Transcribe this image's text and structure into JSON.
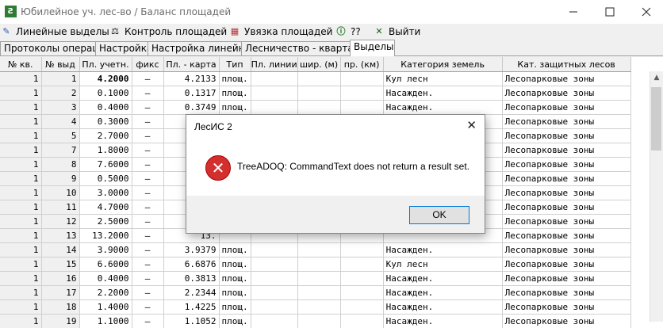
{
  "window": {
    "title": "Юбилейное уч. лес-во / Баланс площадей",
    "app_icon": "leaf-app-icon",
    "controls": [
      "minimize",
      "maximize",
      "close"
    ]
  },
  "toolbar": {
    "items": [
      {
        "label": "Линейные выделы",
        "icon": "pencil-icon"
      },
      {
        "label": "Контроль площадей",
        "icon": "scales-icon"
      },
      {
        "label": "Увязка площадей",
        "icon": "calculator-icon"
      },
      {
        "label": "??",
        "icon": "info-icon"
      },
      {
        "label": "Выйти",
        "icon": "close-x-icon"
      }
    ]
  },
  "tabs": [
    {
      "label": "Протоколы операций"
    },
    {
      "label": "Настройка"
    },
    {
      "label": "Настройка линейных"
    },
    {
      "label": "Лесничество - кварталы"
    },
    {
      "label": "Выделы",
      "active": true
    }
  ],
  "grid": {
    "columns": [
      "№ кв.",
      "№ выд",
      "Пл. учетн.",
      "фикс",
      "Пл. - карта",
      "Тип",
      "Пл. линии",
      "шир. (м)",
      "пр. (км)",
      "Категория земель",
      "Кат. защитных лесов"
    ],
    "rows": [
      [
        "1",
        "1",
        "4.2000",
        "–",
        "4.2133",
        "площ.",
        "",
        "",
        "",
        "Кул лесн",
        "Лесопарковые зоны"
      ],
      [
        "1",
        "2",
        "0.1000",
        "–",
        "0.1317",
        "площ.",
        "",
        "",
        "",
        "Насажден.",
        "Лесопарковые зоны"
      ],
      [
        "1",
        "3",
        "0.4000",
        "–",
        "0.3749",
        "площ.",
        "",
        "",
        "",
        "Насажден.",
        "Лесопарковые зоны"
      ],
      [
        "1",
        "4",
        "0.3000",
        "–",
        "0.",
        "",
        "",
        "",
        "",
        "",
        "Лесопарковые зоны"
      ],
      [
        "1",
        "5",
        "2.7000",
        "–",
        "2.",
        "",
        "",
        "",
        "",
        "",
        "Лесопарковые зоны"
      ],
      [
        "1",
        "7",
        "1.8000",
        "–",
        "1.",
        "",
        "",
        "",
        "",
        "",
        "Лесопарковые зоны"
      ],
      [
        "1",
        "8",
        "7.6000",
        "–",
        "7.",
        "",
        "",
        "",
        "",
        "",
        "Лесопарковые зоны"
      ],
      [
        "1",
        "9",
        "0.5000",
        "–",
        "0.",
        "",
        "",
        "",
        "",
        "",
        "Лесопарковые зоны"
      ],
      [
        "1",
        "10",
        "3.0000",
        "–",
        "3.",
        "",
        "",
        "",
        "",
        "",
        "Лесопарковые зоны"
      ],
      [
        "1",
        "11",
        "4.7000",
        "–",
        "4.",
        "",
        "",
        "",
        "",
        "",
        "Лесопарковые зоны"
      ],
      [
        "1",
        "12",
        "2.5000",
        "–",
        "2.",
        "",
        "",
        "",
        "",
        "",
        "Лесопарковые зоны"
      ],
      [
        "1",
        "13",
        "13.2000",
        "–",
        "13.",
        "",
        "",
        "",
        "",
        "",
        "Лесопарковые зоны"
      ],
      [
        "1",
        "14",
        "3.9000",
        "–",
        "3.9379",
        "площ.",
        "",
        "",
        "",
        "Насажден.",
        "Лесопарковые зоны"
      ],
      [
        "1",
        "15",
        "6.6000",
        "–",
        "6.6876",
        "площ.",
        "",
        "",
        "",
        "Кул лесн",
        "Лесопарковые зоны"
      ],
      [
        "1",
        "16",
        "0.4000",
        "–",
        "0.3813",
        "площ.",
        "",
        "",
        "",
        "Насажден.",
        "Лесопарковые зоны"
      ],
      [
        "1",
        "17",
        "2.2000",
        "–",
        "2.2344",
        "площ.",
        "",
        "",
        "",
        "Насажден.",
        "Лесопарковые зоны"
      ],
      [
        "1",
        "18",
        "1.4000",
        "–",
        "1.4225",
        "площ.",
        "",
        "",
        "",
        "Насажден.",
        "Лесопарковые зоны"
      ],
      [
        "1",
        "19",
        "1.1000",
        "–",
        "1.1052",
        "площ.",
        "",
        "",
        "",
        "Насажден.",
        "Лесопарковые зоны"
      ]
    ]
  },
  "dialog": {
    "title": "ЛесИС 2",
    "message": "TreeADOQ: CommandText does not return a result set.",
    "ok_label": "OK",
    "icon": "error-icon"
  },
  "colors": {
    "error_red": "#d32f2f",
    "ok_border": "#0078d7"
  }
}
